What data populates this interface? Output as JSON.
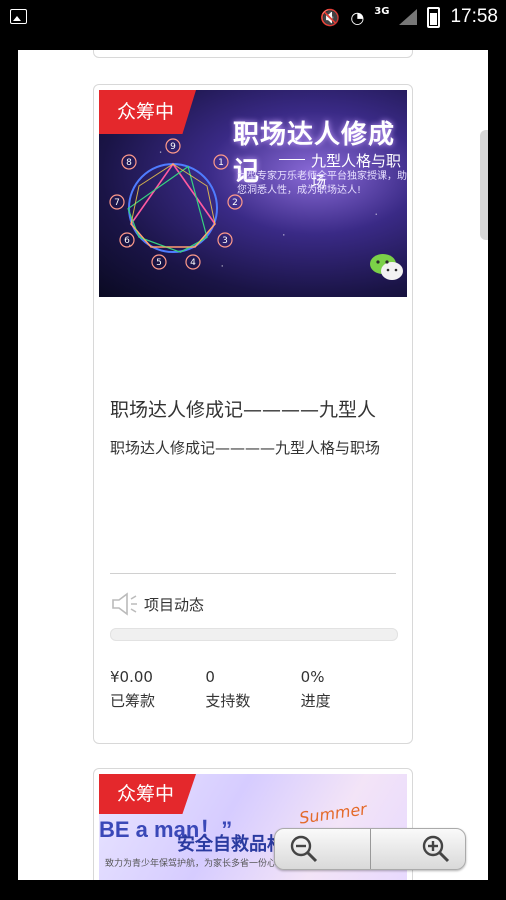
{
  "status_bar": {
    "time": "17:58",
    "network": "3G"
  },
  "cards": [
    {
      "badge": "众筹中",
      "banner": {
        "title": "职场达人修成记",
        "subtitle": "九型人格与职场",
        "desc": "九型专家万乐老师全平台独家授课，助您洞悉人性，成为职场达人!"
      },
      "title": "职场达人修成记————九型人",
      "desc": "职场达人修成记————九型人格与职场",
      "news_label": "项目动态",
      "progress": 0,
      "stats": [
        {
          "value": "¥0.00",
          "label": "已筹款"
        },
        {
          "value": "0",
          "label": "支持数"
        },
        {
          "value": "0%",
          "label": "进度"
        }
      ]
    },
    {
      "badge": "众筹中",
      "banner": {
        "line1": "BE a man！”",
        "line2": "安全自救品格",
        "line3": "致力为青少年保驾护航，为家长多省一份心！",
        "summer": "Summer"
      }
    }
  ],
  "zoom": {
    "out_icon": "zoom-out-icon",
    "in_icon": "zoom-in-icon"
  },
  "colors": {
    "accent": "#e4282c"
  }
}
